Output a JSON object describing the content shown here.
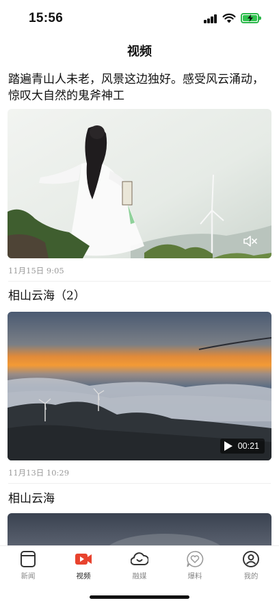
{
  "status_bar": {
    "time": "15:56"
  },
  "header": {
    "title": "视频"
  },
  "feed": {
    "items": [
      {
        "title": "踏遍青山人未老，风景这边独好。感受风云涌动，惊叹大自然的鬼斧神工",
        "date": "11月15日  9:05",
        "control": "mute"
      },
      {
        "title": "相山云海（2）",
        "date": "11月13日  10:29",
        "duration": "00:21"
      },
      {
        "title": "相山云海"
      }
    ]
  },
  "tab_bar": {
    "tabs": [
      {
        "label": "新闻",
        "icon": "news-icon",
        "active": false
      },
      {
        "label": "视频",
        "icon": "video-icon",
        "active": true
      },
      {
        "label": "融媒",
        "icon": "cloud-icon",
        "active": false
      },
      {
        "label": "爆料",
        "icon": "tip-off-heart-icon",
        "active": false
      },
      {
        "label": "我的",
        "icon": "profile-icon",
        "active": false
      }
    ]
  },
  "colors": {
    "accent": "#e8432e",
    "battery": "#30c44f",
    "muted_text": "#9a9a9a"
  }
}
